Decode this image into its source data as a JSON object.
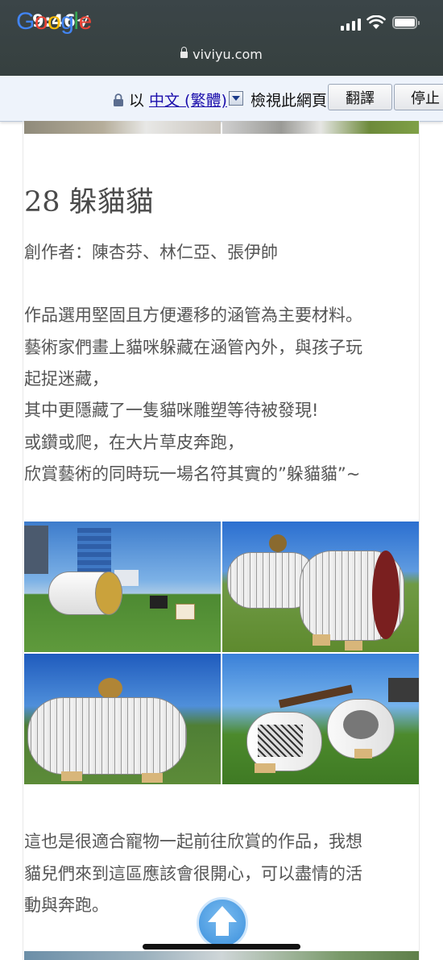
{
  "status_bar": {
    "time": "9:46",
    "url": "viviyu.com"
  },
  "translate_bar": {
    "google_logo": [
      "G",
      "o",
      "o",
      "g",
      "l",
      "e"
    ],
    "prefix": "以",
    "language": "中文 (繁體)",
    "view_text": "檢視此網頁",
    "translate_button": "翻譯",
    "stop_button": "停止"
  },
  "article": {
    "title": "28 躲貓貓",
    "authors": "創作者：陳杏芬、林仁亞、張伊帥",
    "description": [
      "作品選用堅固且方便遷移的涵管為主要材料。",
      "藝術家們畫上貓咪躲藏在涵管內外，與孩子玩",
      "起捉迷藏，",
      "其中更隱藏了一隻貓咪雕塑等待被發現!",
      "或鑽或爬，在大片草皮奔跑，",
      "欣賞藝術的同時玩一場名符其實的”躲貓貓”~"
    ],
    "comment": [
      "這也是很適合寵物一起前往欣賞的作品，我想",
      "貓兒們來到這區應該會很開心，可以盡情的活",
      "動與奔跑。"
    ]
  },
  "icons": {
    "location_arrow": "location-arrow-icon",
    "signal": "cellular-signal-icon",
    "wifi": "wifi-icon",
    "battery": "battery-icon",
    "lock": "lock-icon",
    "scroll_top": "scroll-to-top-icon"
  }
}
